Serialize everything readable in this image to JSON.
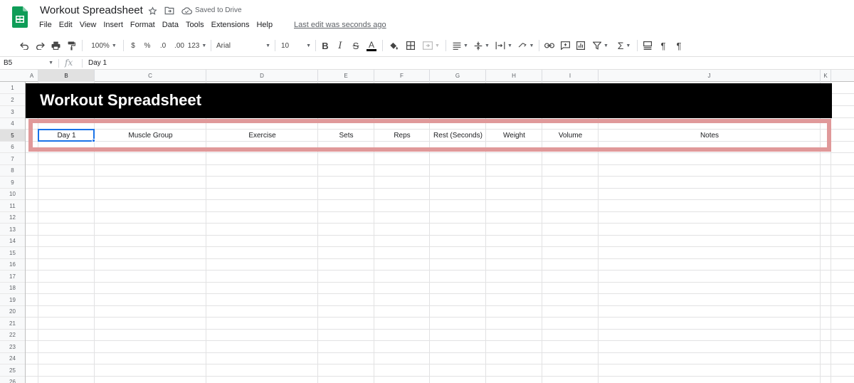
{
  "app": {
    "doc_title": "Workout Spreadsheet",
    "saved_status": "Saved to Drive",
    "last_edit": "Last edit was seconds ago",
    "brand_color": "#0f9d58"
  },
  "menu": [
    "File",
    "Edit",
    "View",
    "Insert",
    "Format",
    "Data",
    "Tools",
    "Extensions",
    "Help"
  ],
  "toolbar": {
    "zoom": "100%",
    "currency": "$",
    "percent": "%",
    "decrease_decimal": ".0",
    "increase_decimal": ".00",
    "more_formats": "123",
    "font": "Arial",
    "font_size": "10",
    "icons": [
      "undo-icon",
      "redo-icon",
      "print-icon",
      "paint-format-icon",
      "bold-icon",
      "italic-icon",
      "strikethrough-icon",
      "text-color-icon",
      "fill-color-icon",
      "borders-icon",
      "merge-icon",
      "align-icon",
      "valign-icon",
      "wrap-icon",
      "rotate-icon",
      "link-icon",
      "comment-icon",
      "chart-icon",
      "filter-icon",
      "functions-icon"
    ]
  },
  "formula_bar": {
    "cell_ref": "B5",
    "fx": "fx",
    "content": "Day 1"
  },
  "grid": {
    "columns": [
      "A",
      "B",
      "C",
      "D",
      "E",
      "F",
      "G",
      "H",
      "I",
      "J",
      "K"
    ],
    "rows": [
      "1",
      "2",
      "3",
      "4",
      "5",
      "6",
      "7",
      "8",
      "9",
      "10",
      "11",
      "12",
      "13",
      "14",
      "15",
      "16",
      "17",
      "18",
      "19",
      "20",
      "21",
      "22",
      "23",
      "24",
      "25",
      "26"
    ],
    "banner_title": "Workout Spreadsheet",
    "header_row": [
      "Day 1",
      "Muscle Group",
      "Exercise",
      "Sets",
      "Reps",
      "Rest (Seconds)",
      "Weight",
      "Volume",
      "Notes"
    ],
    "selected_cell": "B5",
    "highlight_color": "#e0999a",
    "selection_color": "#1a73e8"
  }
}
